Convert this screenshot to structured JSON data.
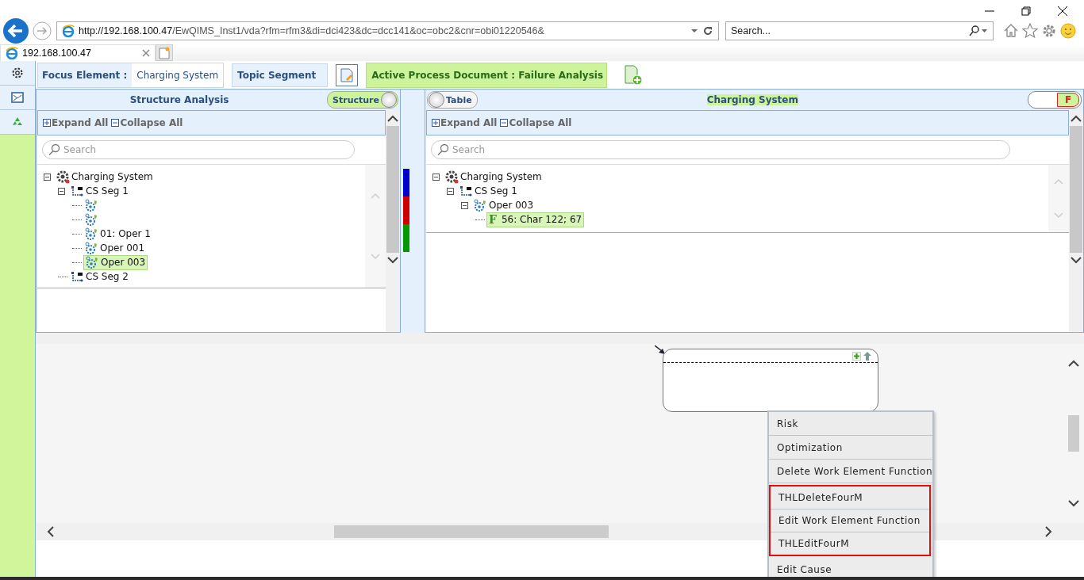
{
  "browser": {
    "url_host": "http://192.168.100.47",
    "url_path": "/EwQIMS_Inst1/vda?rfm=rfm3&di=dci423&dc=dcc141&oc=obc2&cnr=obi01220546&",
    "search_placeholder": "Search...",
    "tab_title": "192.168.100.47"
  },
  "sidebar": {
    "items": [
      {
        "kind": "settings"
      },
      {
        "kind": "mail"
      },
      {
        "kind": "recycle"
      }
    ]
  },
  "topbar": {
    "focus_label": "Focus Element :",
    "focus_value": "Charging System",
    "topic": "Topic Segment",
    "active_document": "Active Process Document : Failure Analysis"
  },
  "left_panel": {
    "title": "Structure Analysis",
    "toggle": {
      "label": "Structure",
      "on": true
    },
    "expand_all": "Expand All",
    "collapse_all": "Collapse All",
    "search_placeholder": "Search",
    "nodes": [
      {
        "kind": "system",
        "label": "Charging System",
        "expanded": true,
        "selected": false,
        "children": [
          {
            "kind": "segment",
            "label": "CS Seg 1",
            "expanded": true,
            "selected": false,
            "children": [
              {
                "kind": "operation",
                "selected": false
              },
              {
                "kind": "operation",
                "selected": false
              },
              {
                "kind": "operation",
                "label": "01: Oper 1",
                "selected": false
              },
              {
                "kind": "operation",
                "label": "Oper 001",
                "selected": false
              },
              {
                "kind": "operation",
                "label": "Oper 003",
                "selected": true
              }
            ]
          },
          {
            "kind": "segment",
            "label": "CS Seg 2",
            "selected": false
          }
        ]
      }
    ]
  },
  "color_strip": [
    {
      "color": "#0000cc"
    },
    {
      "color": "#cc0000"
    },
    {
      "color": "#009900"
    }
  ],
  "right_panel": {
    "title": "Charging System",
    "toggle": {
      "label": "Table",
      "on": false
    },
    "mode_toggle": {
      "label": "F",
      "on": true
    },
    "expand_all": "Expand All",
    "collapse_all": "Collapse All",
    "search_placeholder": "Search",
    "nodes": [
      {
        "kind": "system",
        "label": "Charging System",
        "expanded": true,
        "selected": false,
        "children": [
          {
            "kind": "segment",
            "label": "CS Seg 1",
            "expanded": true,
            "selected": false,
            "children": [
              {
                "kind": "operation",
                "label": "Oper 003",
                "expanded": true,
                "selected": false,
                "children": [
                  {
                    "kind": "characteristic",
                    "mark": "F",
                    "label": "56: Char 122; 67",
                    "selected": true
                  }
                ]
              }
            ]
          }
        ]
      }
    ]
  },
  "context_menu": {
    "items": [
      {
        "label": "Risk",
        "highlighted": false
      },
      {
        "label": "Optimization",
        "highlighted": false
      },
      {
        "label": "Delete Work Element Function",
        "highlighted": false
      },
      {
        "label": "THLDeleteFourM",
        "highlighted": true
      },
      {
        "label": "Edit Work Element Function",
        "highlighted": true
      },
      {
        "label": "THLEditFourM",
        "highlighted": true
      },
      {
        "label": "Edit Cause",
        "highlighted": false
      }
    ]
  }
}
